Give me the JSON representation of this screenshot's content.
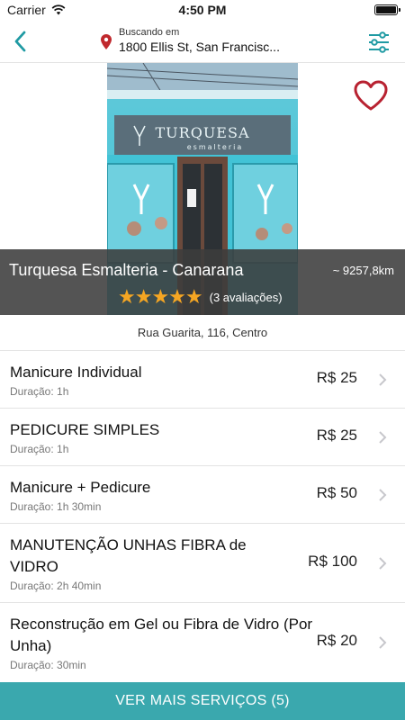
{
  "status_bar": {
    "carrier": "Carrier",
    "time": "4:50 PM"
  },
  "nav": {
    "location_label": "Buscando em",
    "location_address": "1800 Ellis St, San Francisc...",
    "accent_color": "#1f9aa3",
    "pin_color": "#c0282d"
  },
  "shop": {
    "name": "Turquesa Esmalteria - Canarana",
    "distance": "~ 9257,8km",
    "rating": 5,
    "reviews": "(3 avaliações)",
    "address": "Rua Guarita, 116, Centro",
    "sign_title": "TURQUESA",
    "sign_subtitle": "esmalteria"
  },
  "services": [
    {
      "name": "Manicure Individual",
      "duration": "Duração: 1h",
      "price": "R$ 25"
    },
    {
      "name": "PEDICURE SIMPLES",
      "duration": "Duração: 1h",
      "price": "R$ 25"
    },
    {
      "name": "Manicure + Pedicure",
      "duration": "Duração: 1h 30min",
      "price": "R$ 50"
    },
    {
      "name": "MANUTENÇÃO UNHAS FIBRA de VIDRO",
      "duration": "Duração: 2h 40min",
      "price": "R$ 100"
    },
    {
      "name": "Reconstrução em Gel ou Fibra de Vidro (Por Unha)",
      "duration": "Duração: 30min",
      "price": "R$ 20"
    }
  ],
  "cta": {
    "label": "VER MAIS SERVIÇOS (5)",
    "color": "#3aa8ae"
  },
  "icons": [
    "back-arrow-icon",
    "location-pin-icon",
    "filter-sliders-icon",
    "heart-icon",
    "star-icon",
    "chevron-right-icon",
    "wifi-icon",
    "battery-icon"
  ]
}
